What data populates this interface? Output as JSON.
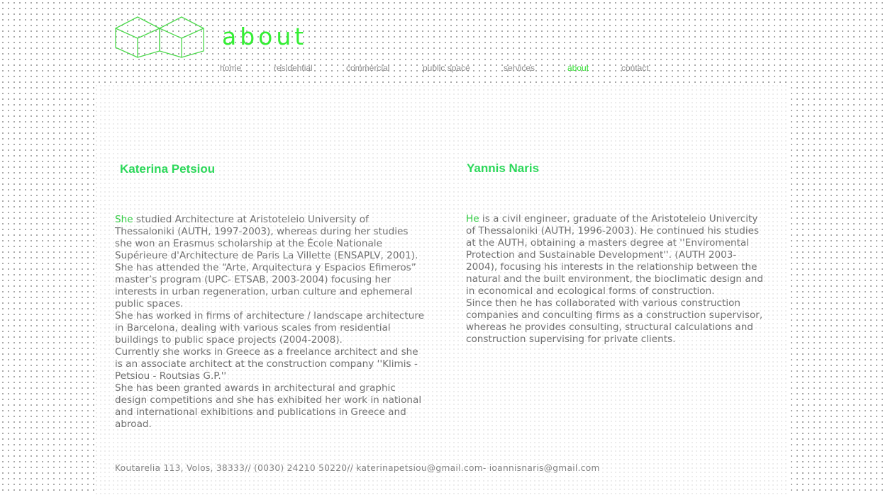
{
  "colors": {
    "accent": "#33ee33",
    "name_green": "#2cd85a",
    "text_gray": "#707070",
    "nav_gray": "#8a8a8a",
    "logo_green": "#4cd94c"
  },
  "logo": {
    "icon": "twin-cubes-logo-icon"
  },
  "page": {
    "title": "about"
  },
  "nav": {
    "items": [
      {
        "label": "home",
        "active": false
      },
      {
        "label": "residential",
        "active": false
      },
      {
        "label": "commercial",
        "active": false
      },
      {
        "label": "public space",
        "active": false
      },
      {
        "label": "services",
        "active": false
      },
      {
        "label": "about",
        "active": true
      },
      {
        "label": "contact",
        "active": false
      }
    ]
  },
  "people": [
    {
      "name": "Katerina Petsiou",
      "lead": "She",
      "paragraphs": [
        " studied Architecture at Aristoteleio University of Thessaloniki (AUTH, 1997-2003), whereas during her studies she won an Erasmus scholarship at the École Nationale Supérieure d'Architecture de Paris La Villette (ENSAPLV, 2001). She has attended the “Arte, Arquitectura y Espacios Efimeros” master’s program (UPC- ETSAB, 2003-2004) focusing her interests in urban regeneration, urban culture and ephemeral public spaces.",
        "She has worked in firms of architecture / landscape architecture in Barcelona, dealing with various scales from residential buildings to public space projects (2004-2008).",
        "Currently she works in Greece as a freelance architect and she is an associate architect at the construction company ''Klimis - Petsiou - Routsias G.P.''",
        "She has been granted awards in architectural and graphic design competitions and she has exhibited her work in national and international exhibitions and publications in Greece and abroad."
      ]
    },
    {
      "name": "Yannis Naris",
      "lead": "He",
      "paragraphs": [
        " is a civil engineer, graduate of the Aristoteleio Univercity of Thessaloniki (AUTH, 1996-2003). He continued his studies at the AUTH, obtaining a masters degree at ''Enviromental Protection and Sustainable Development''. (AUTH 2003-2004), focusing his interests in the relationship between the natural and the built environment, the bioclimatic design and in economical and ecological forms of construction.",
        "Since then he has collaborated with various construction companies and conculting firms as a construction supervisor, whereas he provides consulting, structural calculations and construction supervising for private clients."
      ]
    }
  ],
  "footer": {
    "text": "Koutarelia 113, Volos, 38333// (0030) 24210 50220// katerinapetsiou@gmail.com- ioannisnaris@gmail.com"
  }
}
